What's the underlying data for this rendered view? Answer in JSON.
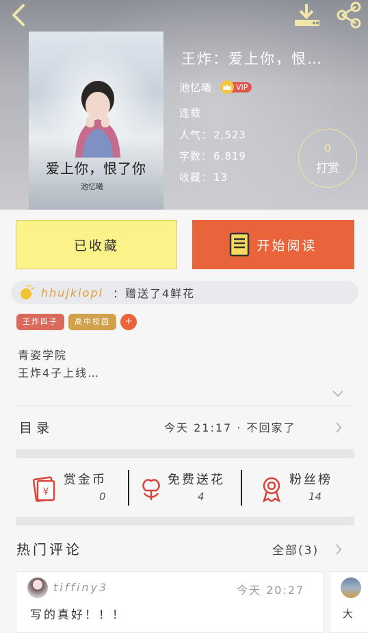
{
  "header": {
    "book_title": "王炸：爱上你，恨…",
    "author": "池忆曦",
    "vip": "VIP",
    "status": "连载",
    "popularity_label": "人气：",
    "popularity": "2,523",
    "words_label": "字数：",
    "words": "6,819",
    "favorites_label": "收藏：",
    "favorites": "13",
    "tip_count": "0",
    "tip_label": "打赏"
  },
  "cover": {
    "title": "爱上你，恨了你",
    "author": "池忆曦"
  },
  "actions": {
    "collected_label": "已收藏",
    "read_label": "开始阅读"
  },
  "flower_feed": {
    "user": "hhujkiopl",
    "message": "：赠送了4鲜花"
  },
  "tags": [
    {
      "label": "王炸四子"
    },
    {
      "label": "高中校园"
    }
  ],
  "tag_add": "+",
  "intro": {
    "line1": "青姿学院",
    "line2": "王炸4子上线…"
  },
  "toc": {
    "label": "目录",
    "latest": "今天 21:17 · 不回家了"
  },
  "stats": {
    "coins_label": "赏金币",
    "coins": "0",
    "flowers_label": "免费送花",
    "flowers": "4",
    "fans_label": "粉丝榜",
    "fans": "14"
  },
  "comments_section": {
    "title": "热门评论",
    "all_label": "全部(3)"
  },
  "comments": [
    {
      "user": "tiffiny3",
      "time": "今天 20:27",
      "text": "写的真好！！！"
    },
    {
      "text": "大"
    }
  ],
  "colors": {
    "accent_orange": "#e9643a",
    "collected_yellow": "#fbf28a",
    "vip_red": "#e2574c",
    "stat_icon_red": "#d9443a"
  }
}
